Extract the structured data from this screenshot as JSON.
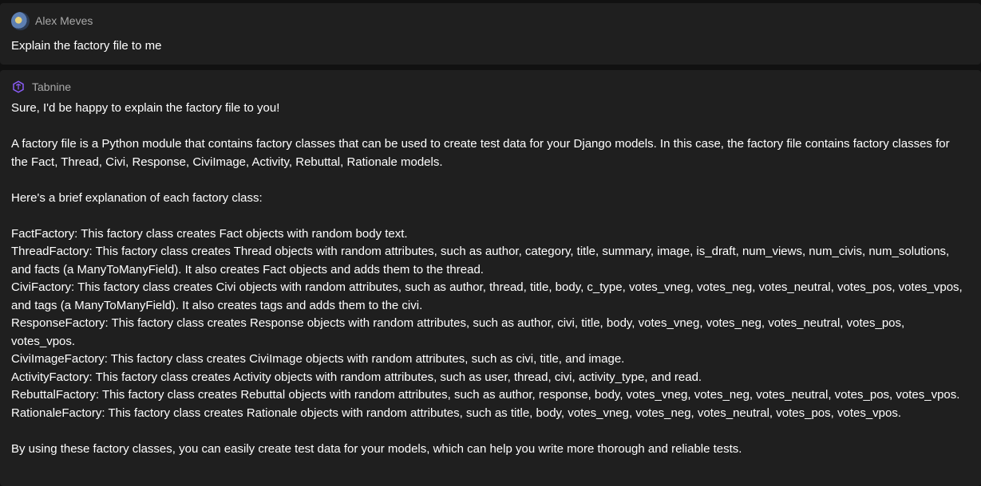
{
  "user_message": {
    "author": "Alex Meves",
    "avatar_icon": "user-avatar",
    "text": "Explain the factory file to me"
  },
  "assistant_message": {
    "author": "Tabnine",
    "logo_icon": "tabnine-logo-icon",
    "logo_color": "#8a5cf6",
    "intro": "Sure, I'd be happy to explain the factory file to you!",
    "description": "A factory file is a Python module that contains factory classes that can be used to create test data for your Django models. In this case, the factory file contains factory classes for the Fact, Thread, Civi, Response, CiviImage, Activity, Rebuttal, Rationale models.",
    "list_intro": "Here's a brief explanation of each factory class:",
    "factories": [
      "FactFactory: This factory class creates Fact objects with random body text.",
      "ThreadFactory: This factory class creates Thread objects with random attributes, such as author, category, title, summary, image, is_draft, num_views, num_civis, num_solutions, and facts (a ManyToManyField). It also creates Fact objects and adds them to the thread.",
      "CiviFactory: This factory class creates Civi objects with random attributes, such as author, thread, title, body, c_type, votes_vneg, votes_neg, votes_neutral, votes_pos, votes_vpos, and tags (a ManyToManyField). It also creates tags and adds them to the civi.",
      "ResponseFactory: This factory class creates Response objects with random attributes, such as author, civi, title, body, votes_vneg, votes_neg, votes_neutral, votes_pos, votes_vpos.",
      "CiviImageFactory: This factory class creates CiviImage objects with random attributes, such as civi, title, and image.",
      "ActivityFactory: This factory class creates Activity objects with random attributes, such as user, thread, civi, activity_type, and read.",
      "RebuttalFactory: This factory class creates Rebuttal objects with random attributes, such as author, response, body, votes_vneg, votes_neg, votes_neutral, votes_pos, votes_vpos.",
      "RationaleFactory: This factory class creates Rationale objects with random attributes, such as title, body, votes_vneg, votes_neg, votes_neutral, votes_pos, votes_vpos."
    ],
    "conclusion": "By using these factory classes, you can easily create test data for your models, which can help you write more thorough and reliable tests."
  }
}
